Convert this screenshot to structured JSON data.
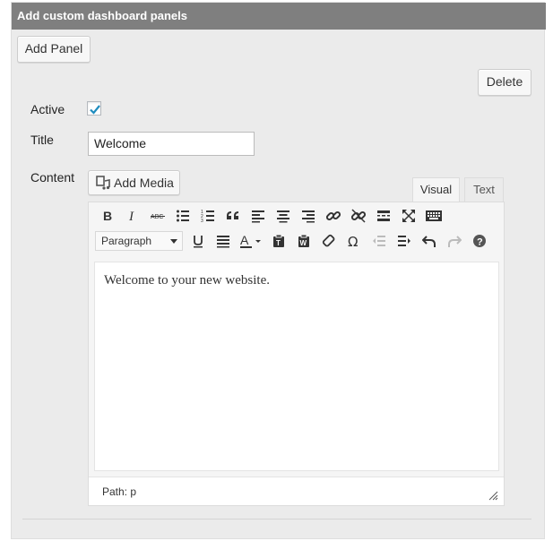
{
  "panel": {
    "title": "Add custom dashboard panels",
    "add_panel_label": "Add Panel",
    "delete_label": "Delete"
  },
  "form": {
    "active_label": "Active",
    "active_checked": true,
    "title_label": "Title",
    "title_value": "Welcome",
    "content_label": "Content"
  },
  "editor": {
    "add_media_label": "Add Media",
    "tabs": [
      {
        "label": "Visual",
        "active": true
      },
      {
        "label": "Text",
        "active": false
      }
    ],
    "toolbar_row1": [
      "bold-icon",
      "italic-icon",
      "strikethrough-icon",
      "bullet-list-icon",
      "numbered-list-icon",
      "blockquote-icon",
      "align-left-icon",
      "align-center-icon",
      "align-right-icon",
      "insert-link-icon",
      "remove-link-icon",
      "read-more-icon",
      "fullscreen-icon",
      "toolbar-toggle-icon"
    ],
    "format_select_value": "Paragraph",
    "toolbar_row2": [
      "underline-icon",
      "justify-icon",
      "text-color-icon",
      "paste-text-icon",
      "paste-word-icon",
      "clear-formatting-icon",
      "special-character-icon",
      "outdent-icon",
      "indent-icon",
      "undo-icon",
      "redo-icon",
      "help-icon"
    ],
    "content_text": "Welcome to your new website.",
    "path_text": "Path: p"
  },
  "colors": {
    "header_bg": "#7f7f7f",
    "panel_bg": "#ebebeb",
    "checkbox_check": "#1e8cbe"
  }
}
